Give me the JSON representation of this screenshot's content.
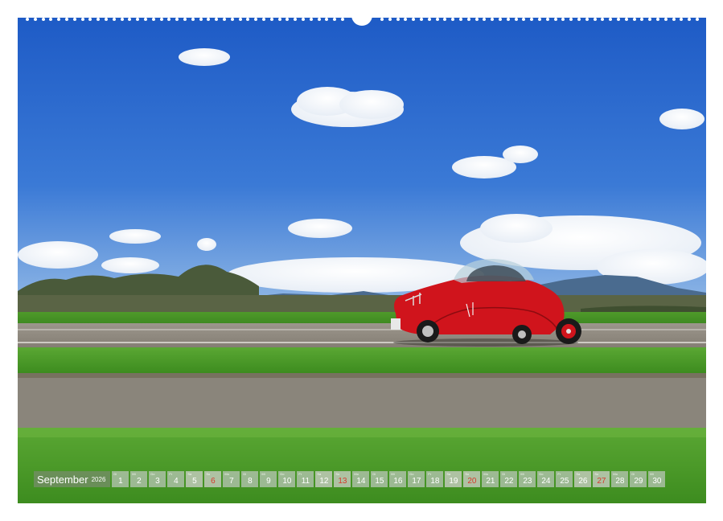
{
  "calendar": {
    "month": "September",
    "year": "2026",
    "days": [
      {
        "num": "1",
        "wd": "Di",
        "type": "weekday"
      },
      {
        "num": "2",
        "wd": "Mi",
        "type": "weekday"
      },
      {
        "num": "3",
        "wd": "Do",
        "type": "weekday"
      },
      {
        "num": "4",
        "wd": "Fr",
        "type": "weekday"
      },
      {
        "num": "5",
        "wd": "Sa",
        "type": "saturday"
      },
      {
        "num": "6",
        "wd": "So",
        "type": "sunday"
      },
      {
        "num": "7",
        "wd": "Mo",
        "type": "weekday"
      },
      {
        "num": "8",
        "wd": "Di",
        "type": "weekday"
      },
      {
        "num": "9",
        "wd": "Mi",
        "type": "weekday"
      },
      {
        "num": "10",
        "wd": "Do",
        "type": "weekday"
      },
      {
        "num": "11",
        "wd": "Fr",
        "type": "weekday"
      },
      {
        "num": "12",
        "wd": "Sa",
        "type": "saturday"
      },
      {
        "num": "13",
        "wd": "So",
        "type": "sunday"
      },
      {
        "num": "14",
        "wd": "Mo",
        "type": "weekday"
      },
      {
        "num": "15",
        "wd": "Di",
        "type": "weekday"
      },
      {
        "num": "16",
        "wd": "Mi",
        "type": "weekday"
      },
      {
        "num": "17",
        "wd": "Do",
        "type": "weekday"
      },
      {
        "num": "18",
        "wd": "Fr",
        "type": "weekday"
      },
      {
        "num": "19",
        "wd": "Sa",
        "type": "saturday"
      },
      {
        "num": "20",
        "wd": "So",
        "type": "sunday"
      },
      {
        "num": "21",
        "wd": "Mo",
        "type": "weekday"
      },
      {
        "num": "22",
        "wd": "Di",
        "type": "weekday"
      },
      {
        "num": "23",
        "wd": "Mi",
        "type": "weekday"
      },
      {
        "num": "24",
        "wd": "Do",
        "type": "weekday"
      },
      {
        "num": "25",
        "wd": "Fr",
        "type": "weekday"
      },
      {
        "num": "26",
        "wd": "Sa",
        "type": "saturday"
      },
      {
        "num": "27",
        "wd": "So",
        "type": "sunday"
      },
      {
        "num": "28",
        "wd": "Mo",
        "type": "weekday"
      },
      {
        "num": "29",
        "wd": "Di",
        "type": "weekday"
      },
      {
        "num": "30",
        "wd": "Mi",
        "type": "weekday"
      }
    ]
  },
  "colors": {
    "sky_top": "#1f5fc9",
    "sky_bottom": "#7fa9de",
    "grass": "#4f9e2e",
    "road": "#8f8a82",
    "car_red": "#d0141c",
    "sunday_red": "#d63a2e"
  }
}
